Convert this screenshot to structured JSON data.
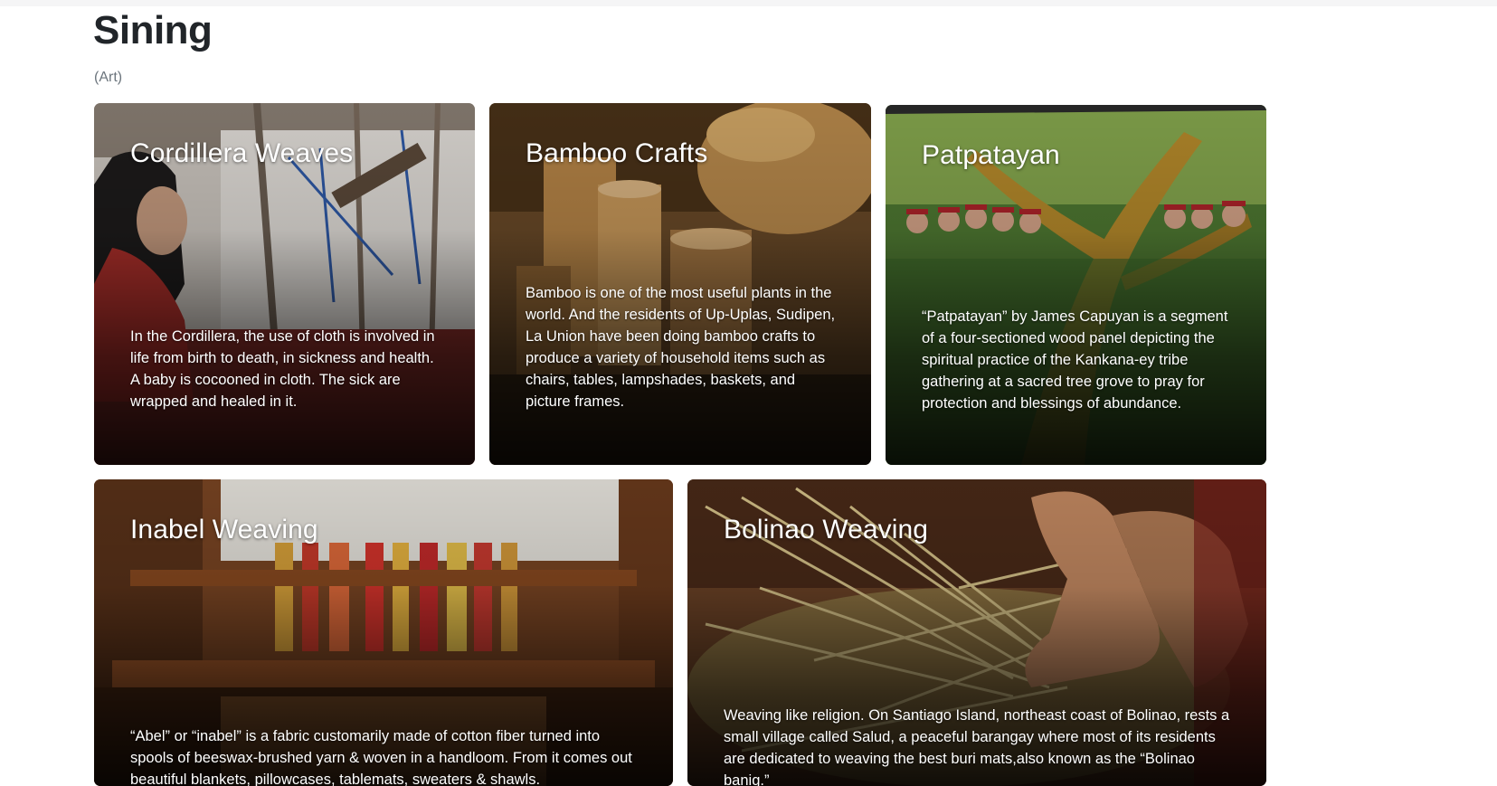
{
  "page": {
    "title": "Sining",
    "subtitle": "(Art)"
  },
  "cards": [
    {
      "title": "Cordillera Weaves",
      "description": "In the Cordillera, the use of cloth is involved in life from birth to death, in sickness and health. A baby is cocooned in cloth. The sick are wrapped and healed in it."
    },
    {
      "title": "Bamboo Crafts",
      "description": "Bamboo is one of the most useful plants in the world. And the residents of Up-Uplas, Sudipen, La Union have been doing bamboo crafts to produce a variety of household items such as chairs, tables, lampshades, baskets, and picture frames."
    },
    {
      "title": "Patpatayan",
      "description": "“Patpatayan” by James Capuyan is a segment of a four-sectioned wood panel depicting the spiritual practice of the Kankana-ey tribe gathering at a sacred tree grove to pray for protection and blessings of abundance."
    },
    {
      "title": "Inabel Weaving",
      "description": "“Abel” or “inabel” is a fabric customarily made of cotton fiber turned into spools of beeswax-brushed yarn & woven in a handloom. From it comes out beautiful blankets, pillowcases, tablemats, sweaters & shawls."
    },
    {
      "title": "Bolinao Weaving",
      "description": "Weaving like religion. On Santiago Island, northeast coast of Bolinao, rests a small village called Salud, a peaceful barangay where most of its residents are dedicated to weaving the best buri mats,also known as the “Bolinao banig.”"
    }
  ]
}
